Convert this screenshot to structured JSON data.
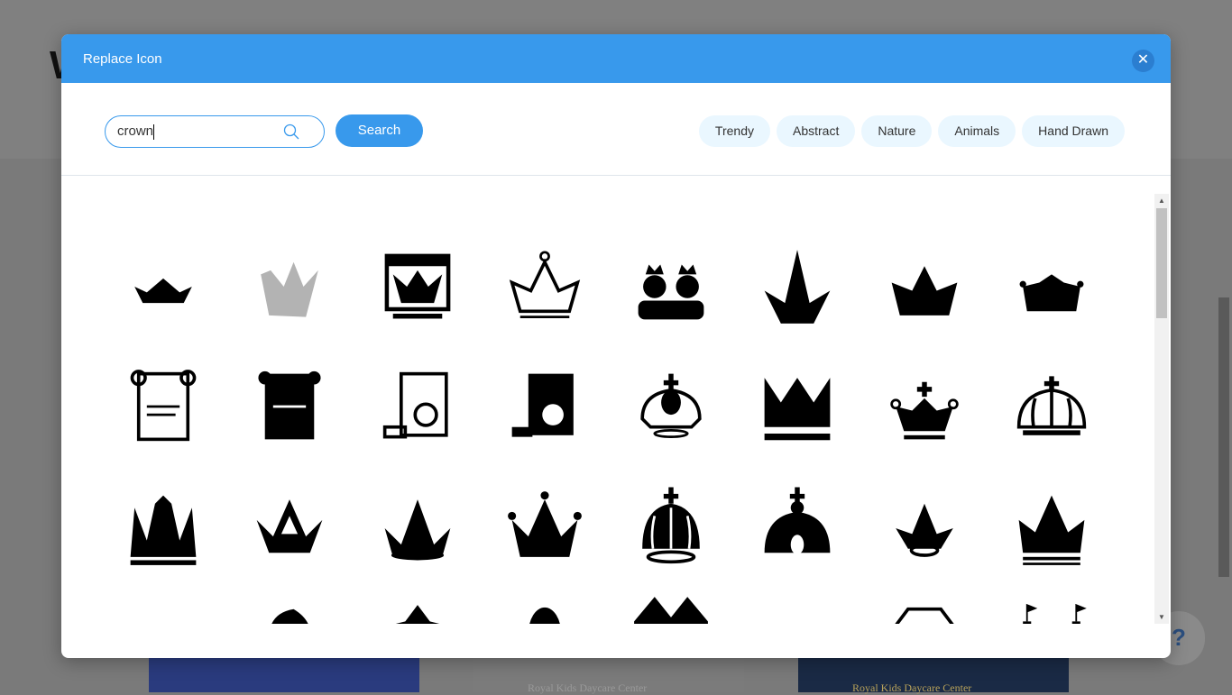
{
  "background": {
    "letter": "W",
    "cards": [
      {
        "text": "",
        "color": "#2a3b7e"
      },
      {
        "text": "Royal Kids Daycare Center",
        "color": "#7b7b7b"
      },
      {
        "text": "Royal Kids Daycare Center",
        "color": "#1a2a45"
      }
    ],
    "help_label": "?"
  },
  "modal": {
    "title": "Replace Icon",
    "close_icon": "close-icon",
    "search": {
      "value": "crown",
      "search_label": "Search"
    },
    "tags": [
      "Trendy",
      "Abstract",
      "Nature",
      "Animals",
      "Hand Drawn"
    ],
    "accent": "#3899ec",
    "icons": [
      "crown-small",
      "crown-gray-handdrawn",
      "crown-browser-window",
      "crown-outline",
      "king-queen-avatars",
      "crown-spike",
      "crown-jeweled",
      "crown-tiara",
      "scroll-outline",
      "scroll-filled",
      "certificate-outline",
      "certificate-filled",
      "royal-crown-cross",
      "crown-block",
      "crown-cross-dots",
      "crown-arch-outline",
      "crown-tall-spikes",
      "crown-winged",
      "crown-curved-jewels",
      "crown-five-points",
      "imperial-crown-dotted",
      "imperial-crown-filled",
      "tiara-ring",
      "crown-ornate",
      "crown-mini",
      "queen-silhouette",
      "pagoda",
      "king-silhouette",
      "crown-flat",
      "crown-thin-lines",
      "diamond",
      "castle"
    ]
  }
}
